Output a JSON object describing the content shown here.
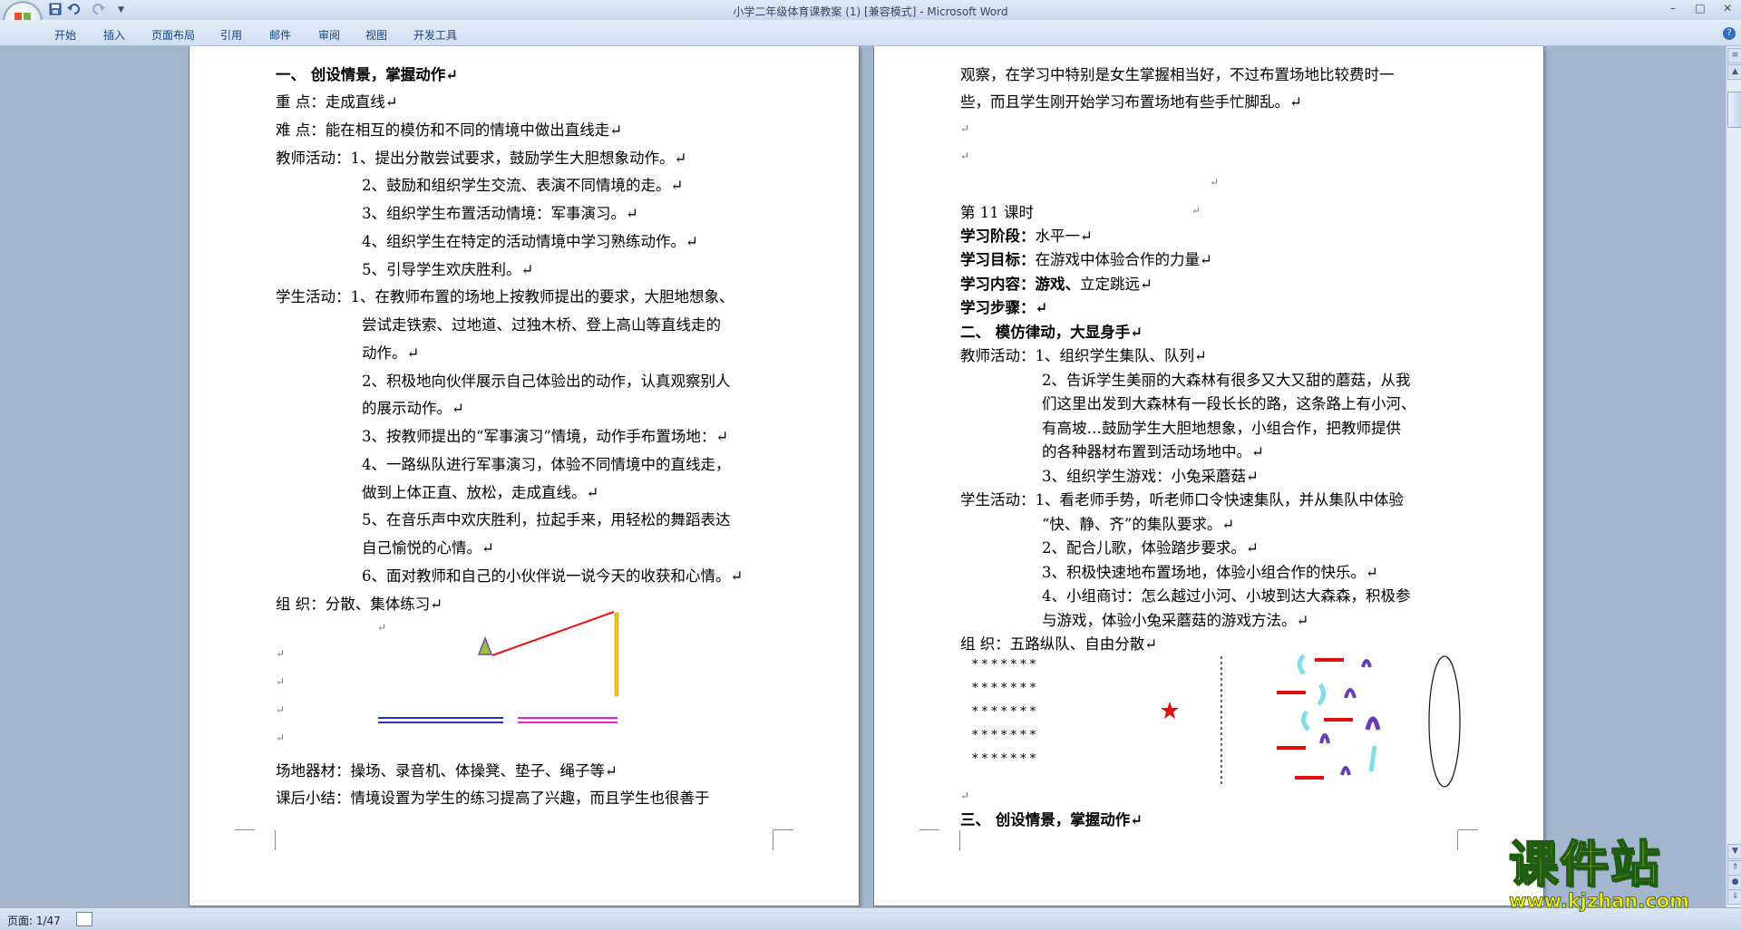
{
  "window": {
    "title": "小学二年级体育课教案 (1) [兼容模式] - Microsoft Word",
    "controls": {
      "minimize": "–",
      "maximize": "□",
      "close": "✕"
    }
  },
  "quick_access": {
    "save_icon": "save-icon",
    "undo_icon": "undo-icon",
    "redo_icon": "redo-icon",
    "customize_icon": "customize-icon"
  },
  "ribbon": {
    "tabs": [
      "开始",
      "插入",
      "页面布局",
      "引用",
      "邮件",
      "审阅",
      "视图",
      "开发工具"
    ],
    "help": "?"
  },
  "page_left": {
    "lines": [
      "一、    创设情景，掌握动作↵",
      "重      点：走成直线↵",
      "难      点：能在相互的模仿和不同的情境中做出直线走↵",
      "教师活动：1、提出分散尝试要求，鼓励学生大胆想象动作。↵",
      "2、鼓励和组织学生交流、表演不同情境的走。↵",
      "3、组织学生布置活动情境：军事演习。↵",
      "4、组织学生在特定的活动情境中学习熟练动作。↵",
      "5、引导学生欢庆胜利。↵",
      "学生活动：1、在教师布置的场地上按教师提出的要求，大胆地想象、",
      "尝试走铁索、过地道、过独木桥、登上高山等直线走的",
      "动作。↵",
      "2、积极地向伙伴展示自己体验出的动作，认真观察别人",
      "的展示动作。↵",
      "3、按教师提出的“军事演习”情境，动作手布置场地：↵",
      "4、一路纵队进行军事演习，体验不同情境中的直线走，",
      "做到上体正直、放松，走成直线。↵",
      "5、在音乐声中欢庆胜利，拉起手来，用轻松的舞蹈表达",
      "自己愉悦的心情。↵",
      "6、面对教师和自己的小伙伴说一说今天的收获和心情。↵",
      "组      织：分散、集体练习↵",
      "场地器材：操场、录音机、体操凳、垫子、绳子等↵",
      "课后小结：情境设置为学生的练习提高了兴趣，而且学生也很善于"
    ],
    "para_mark": "↵"
  },
  "page_right": {
    "lines": [
      "观察，在学习中特别是女生掌握相当好，不过布置场地比较费时一",
      "些，而且学生刚开始学习布置场地有些手忙脚乱。↵",
      "第 11 课时",
      "学习阶段：",
      "水平一↵",
      "学习目标：",
      "在游戏中体验合作的力量↵",
      "学习内容：",
      "游戏、",
      "立定跳远↵",
      "学习步骤：↵",
      "二、    模仿律动，大显身手↵",
      "教师活动：1、组织学生集队、队列↵",
      "2、告诉学生美丽的大森林有很多又大又甜的蘑菇，从我",
      "们这里出发到大森林有一段长长的路，这条路上有小河、",
      "有高坡…鼓励学生大胆地想象，小组合作，把教师提供",
      "的各种器材布置到活动场地中。↵",
      "3、组织学生游戏：小兔采蘑菇↵",
      "学生活动：1、看老师手势，听老师口令快速集队，并从集队中体验",
      "“快、静、齐”的集队要求。↵",
      "2、配合儿歌，体验踏步要求。↵",
      "3、积极快速地布置场地，体验小组合作的快乐。↵",
      "4、小组商讨：怎么越过小河、小坡到达大森森，积极参",
      "与游戏，体验小兔采蘑菇的游戏方法。↵",
      "组      织：五路纵队、自由分散↵",
      "三、    创设情景，掌握动作↵"
    ],
    "formation_row": "* * * * * * *",
    "para_mark": "↵"
  },
  "statusbar": {
    "page": "页面: 1/47"
  },
  "watermark": {
    "main": "课件站",
    "url": "www.kjzhan.com"
  },
  "colors": {
    "chrome": "#dfe9f5",
    "doc_bg": "#a4b6cf",
    "ribbon_text": "#15428b",
    "watermark_fill": "#ffe31a",
    "watermark_stroke": "#1f5e12"
  }
}
